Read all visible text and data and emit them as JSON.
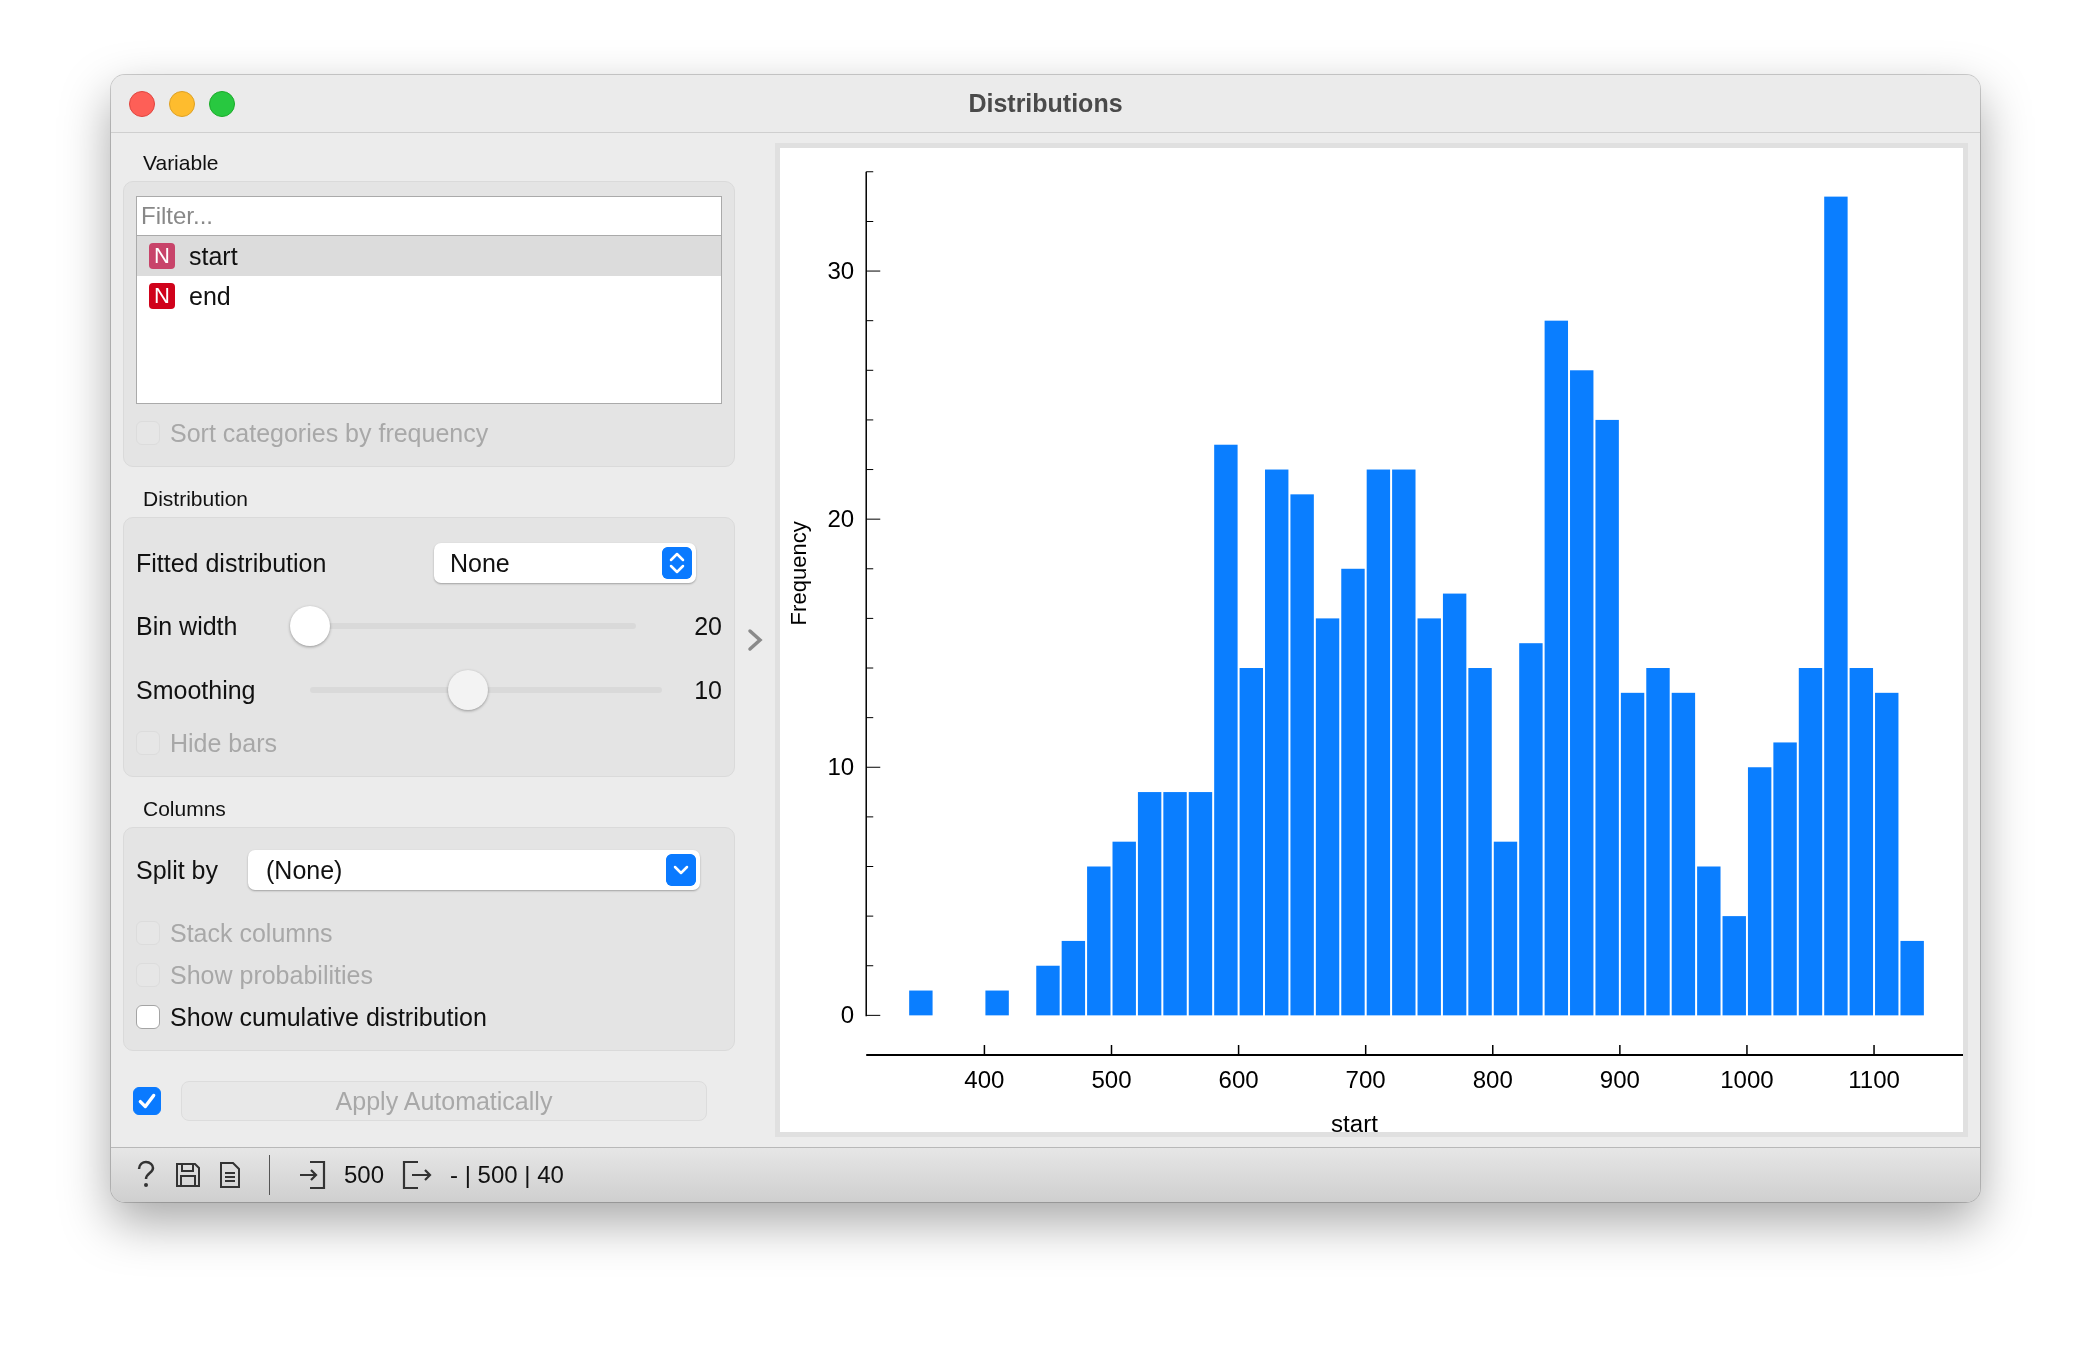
{
  "window": {
    "title": "Distributions"
  },
  "variable": {
    "title": "Variable",
    "filter": {
      "placeholder": "Filter..."
    },
    "items": [
      {
        "badge": "N",
        "name": "start",
        "selected": true
      },
      {
        "badge": "N",
        "name": "end",
        "selected": false
      }
    ],
    "sort_option": {
      "label": "Sort categories by frequency",
      "checked": false,
      "disabled": true
    }
  },
  "distribution": {
    "title": "Distribution",
    "fitted": {
      "label": "Fitted distribution",
      "value": "None"
    },
    "sliders": [
      {
        "label": "Bin width",
        "level": 0,
        "reading": "20"
      },
      {
        "label": "Smoothing",
        "level": 0.45,
        "reading": "10"
      }
    ],
    "hide_bars": {
      "label": "Hide bars",
      "checked": false,
      "disabled": true
    }
  },
  "columns": {
    "title": "Columns",
    "split_by": {
      "label": "Split by",
      "value": "(None)"
    },
    "options": [
      {
        "label": "Stack columns",
        "checked": false,
        "disabled": true
      },
      {
        "label": "Show probabilities",
        "checked": false,
        "disabled": true
      },
      {
        "label": "Show cumulative distribution",
        "checked": false,
        "disabled": false
      }
    ]
  },
  "apply": {
    "checked": true,
    "label": "Apply Automatically",
    "disabled": true
  },
  "plot": {
    "chart_data": {
      "type": "bar",
      "xlabel": "start",
      "ylabel": "Frequency",
      "x": [
        350,
        410,
        450,
        470,
        490,
        510,
        530,
        550,
        570,
        590,
        610,
        630,
        650,
        670,
        690,
        710,
        730,
        750,
        770,
        790,
        810,
        830,
        850,
        870,
        890,
        910,
        930,
        950,
        970,
        990,
        1010,
        1030,
        1050,
        1070,
        1090,
        1110,
        1130
      ],
      "values": [
        1,
        1,
        2,
        3,
        6,
        7,
        9,
        9,
        9,
        23,
        14,
        22,
        21,
        16,
        18,
        22,
        22,
        16,
        17,
        14,
        7,
        15,
        28,
        26,
        24,
        13,
        14,
        13,
        6,
        4,
        10,
        11,
        14,
        33,
        14,
        13,
        3
      ],
      "xlim": [
        307,
        1170
      ],
      "ylim": [
        -1.6,
        34
      ],
      "xticks": [
        400,
        500,
        600,
        700,
        800,
        900,
        1000,
        1100
      ],
      "yticks": [
        0,
        10,
        20,
        30
      ]
    }
  },
  "status_bar": {
    "input_count": "500",
    "output_summary": "- | 500 | 40"
  }
}
